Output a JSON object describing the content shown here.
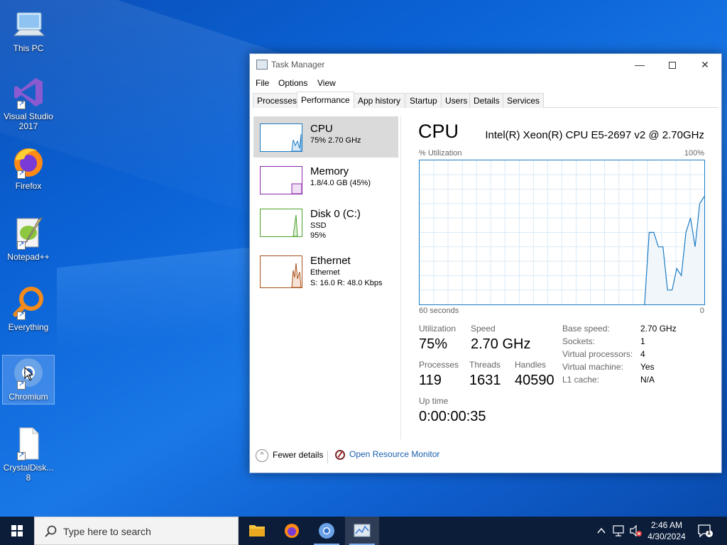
{
  "desktop": {
    "icons": [
      {
        "label": "This PC"
      },
      {
        "label": "Visual Studio 2017"
      },
      {
        "label": "Firefox"
      },
      {
        "label": "Notepad++"
      },
      {
        "label": "Everything"
      },
      {
        "label": "Chromium"
      },
      {
        "label": "CrystalDisk... 8"
      }
    ]
  },
  "window": {
    "title": "Task Manager",
    "menu": [
      "File",
      "Options",
      "View"
    ],
    "tabs": [
      "Processes",
      "Performance",
      "App history",
      "Startup",
      "Users",
      "Details",
      "Services"
    ],
    "active_tab": "Performance"
  },
  "resources": [
    {
      "name": "CPU",
      "line1": "75%  2.70 GHz",
      "line2": "",
      "color": "#1b7cc4"
    },
    {
      "name": "Memory",
      "line1": "1.8/4.0 GB (45%)",
      "line2": "",
      "color": "#8b2aa8"
    },
    {
      "name": "Disk 0 (C:)",
      "line1": "SSD",
      "line2": "95%",
      "color": "#4aa02c"
    },
    {
      "name": "Ethernet",
      "line1": "Ethernet",
      "line2": "S: 16.0  R: 48.0 Kbps",
      "color": "#a9501a"
    }
  ],
  "detail": {
    "title": "CPU",
    "model": "Intel(R) Xeon(R) CPU E5-2697 v2 @ 2.70GHz",
    "graph_label": "% Utilization",
    "graph_max": "100%",
    "graph_time": "60 seconds",
    "graph_min": "0",
    "graph_color": "#1b7cc4",
    "utilization_samples": [
      0,
      0,
      0,
      0,
      0,
      0,
      0,
      0,
      0,
      0,
      0,
      0,
      0,
      0,
      0,
      0,
      0,
      0,
      0,
      0,
      0,
      0,
      0,
      0,
      0,
      0,
      0,
      0,
      0,
      0,
      0,
      0,
      0,
      0,
      0,
      0,
      0,
      0,
      0,
      0,
      0,
      0,
      0,
      0,
      0,
      0,
      0,
      0,
      0,
      0,
      50,
      50,
      40,
      40,
      10,
      10,
      25,
      20,
      50,
      60,
      40,
      70,
      75
    ],
    "stats": {
      "utilization_label": "Utilization",
      "utilization": "75%",
      "speed_label": "Speed",
      "speed": "2.70 GHz",
      "processes_label": "Processes",
      "processes": "119",
      "threads_label": "Threads",
      "threads": "1631",
      "handles_label": "Handles",
      "handles": "40590",
      "uptime_label": "Up time",
      "uptime": "0:00:00:35"
    },
    "specs": [
      {
        "key": "Base speed:",
        "value": "2.70 GHz"
      },
      {
        "key": "Sockets:",
        "value": "1"
      },
      {
        "key": "Virtual processors:",
        "value": "4"
      },
      {
        "key": "Virtual machine:",
        "value": "Yes"
      },
      {
        "key": "L1 cache:",
        "value": "N/A"
      }
    ]
  },
  "footer": {
    "fewer_details": "Fewer details",
    "open_resource_monitor": "Open Resource Monitor"
  },
  "taskbar": {
    "search_placeholder": "Type here to search",
    "time": "2:46 AM",
    "date": "4/30/2024",
    "notification_count": "1"
  }
}
